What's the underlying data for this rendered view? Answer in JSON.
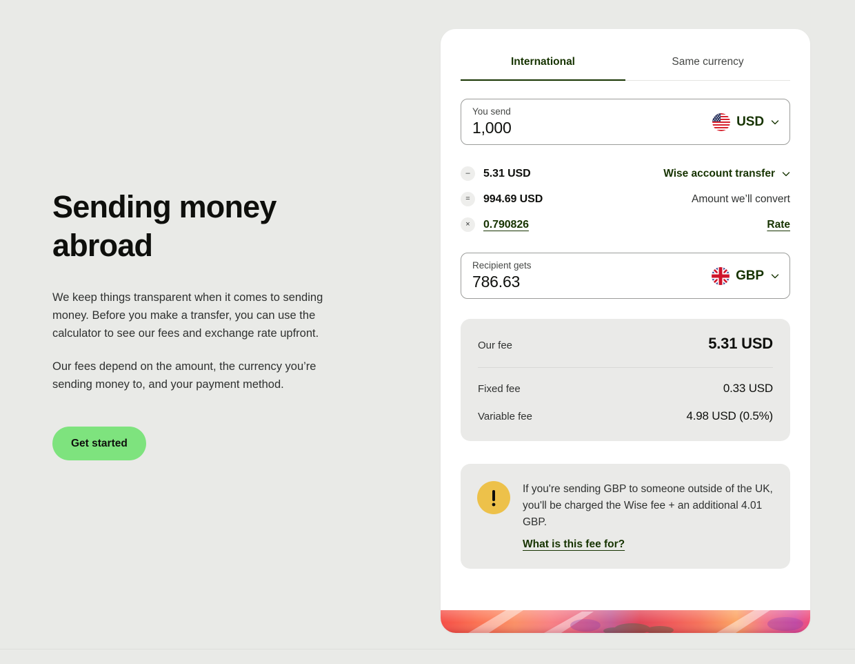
{
  "theme": {
    "page_background": "#e9eae7",
    "card_background": "#ffffff",
    "accent_green": "#163300",
    "cta_green": "#7ee37e",
    "panel_gray": "#eaeae8",
    "alert_yellow": "#edc14a"
  },
  "marketing": {
    "headline": "Sending money abroad",
    "paragraph_1": "We keep things transparent when it comes to sending money. Before you make a transfer, you can use the calculator to see our fees and exchange rate upfront.",
    "paragraph_2": "Our fees depend on the amount, the currency you’re sending money to, and your payment method.",
    "cta_label": "Get started"
  },
  "calculator": {
    "tabs": [
      {
        "label": "International",
        "active": true
      },
      {
        "label": "Same currency",
        "active": false
      }
    ],
    "send": {
      "label": "You send",
      "value": "1,000",
      "placeholder": "0",
      "currency": "USD",
      "flag": "us-flag-icon",
      "chevron": "chevron-down-icon"
    },
    "breakdown": [
      {
        "operator": "–",
        "operator_name": "minus",
        "value": "5.31 USD",
        "right_label": "Wise account transfer",
        "right_type": "dropdown"
      },
      {
        "operator": "=",
        "operator_name": "equals",
        "value": "994.69 USD",
        "right_label": "Amount we’ll convert",
        "right_type": "text"
      },
      {
        "operator": "×",
        "operator_name": "multiply",
        "value": "0.790826",
        "right_label": "Rate",
        "right_type": "link"
      }
    ],
    "receive": {
      "label": "Recipient gets",
      "value": "786.63",
      "placeholder": "0",
      "currency": "GBP",
      "flag": "gb-flag-icon",
      "chevron": "chevron-down-icon"
    },
    "fees": {
      "total_label": "Our fee",
      "total_value": "5.31 USD",
      "rows": [
        {
          "label": "Fixed fee",
          "value": "0.33 USD"
        },
        {
          "label": "Variable fee",
          "value": "4.98 USD (0.5%)"
        }
      ]
    },
    "alert": {
      "icon": "exclamation-icon",
      "text": "If you're sending GBP to someone outside of the UK, you'll be charged the Wise fee + an additional 4.01 GBP.",
      "link_label": "What is this fee for?"
    }
  }
}
